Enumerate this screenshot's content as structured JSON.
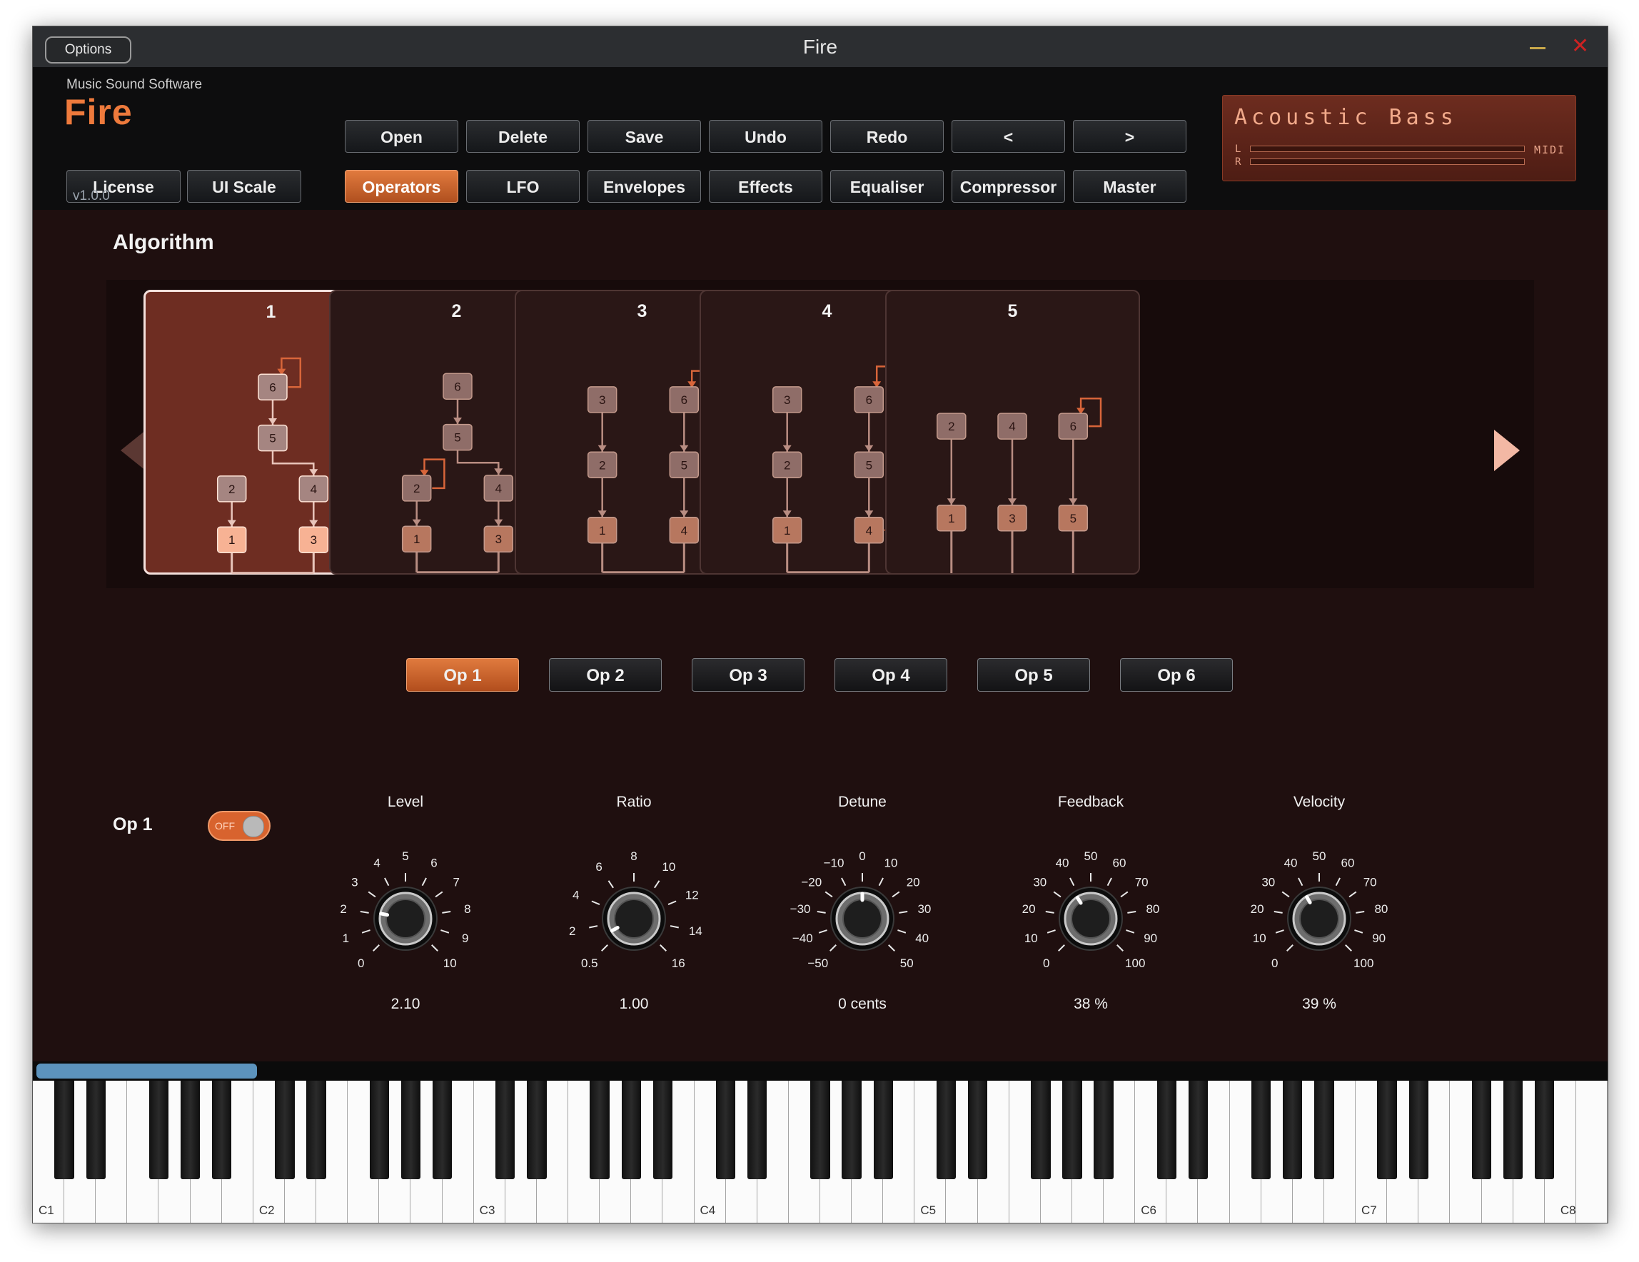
{
  "window": {
    "title": "Fire",
    "options_label": "Options"
  },
  "brand": {
    "company": "Music Sound Software",
    "name": "Fire",
    "version": "v1.0.0"
  },
  "header": {
    "left_buttons": [
      "License",
      "UI Scale"
    ],
    "top_row": [
      "Open",
      "Delete",
      "Save",
      "Undo",
      "Redo",
      "<",
      ">"
    ],
    "tabs": [
      "Operators",
      "LFO",
      "Envelopes",
      "Effects",
      "Equaliser",
      "Compressor",
      "Master"
    ],
    "active_tab": "Operators"
  },
  "preset": {
    "name": "Acoustic Bass",
    "meter_left": "L",
    "meter_right": "R",
    "midi": "MIDI"
  },
  "algorithm": {
    "title": "Algorithm",
    "selected": "1",
    "cards": [
      {
        "label": "1"
      },
      {
        "label": "2"
      },
      {
        "label": "3"
      },
      {
        "label": "4"
      },
      {
        "label": "5"
      }
    ]
  },
  "operators": {
    "buttons": [
      "Op 1",
      "Op 2",
      "Op 3",
      "Op 4",
      "Op 5",
      "Op 6"
    ],
    "active": "Op 1"
  },
  "op_panel": {
    "label": "Op 1",
    "toggle_text": "OFF",
    "knobs": [
      {
        "name": "Level",
        "value": "2.10",
        "ticks": [
          "0",
          "1",
          "2",
          "3",
          "4",
          "5",
          "6",
          "7",
          "8",
          "9",
          "10"
        ],
        "fraction": 0.21
      },
      {
        "name": "Ratio",
        "value": "1.00",
        "ticks": [
          "0.5",
          "2",
          "4",
          "6",
          "8",
          "10",
          "12",
          "14",
          "16"
        ],
        "fraction": 0.06
      },
      {
        "name": "Detune",
        "value": "0 cents",
        "ticks": [
          "−50",
          "−40",
          "−30",
          "−20",
          "−10",
          "0",
          "10",
          "20",
          "30",
          "40",
          "50"
        ],
        "fraction": 0.5
      },
      {
        "name": "Feedback",
        "value": "38 %",
        "ticks": [
          "0",
          "10",
          "20",
          "30",
          "40",
          "50",
          "60",
          "70",
          "80",
          "90",
          "100"
        ],
        "fraction": 0.38
      },
      {
        "name": "Velocity",
        "value": "39 %",
        "ticks": [
          "0",
          "10",
          "20",
          "30",
          "40",
          "50",
          "60",
          "70",
          "80",
          "90",
          "100"
        ],
        "fraction": 0.39
      }
    ]
  },
  "keyboard": {
    "octave_labels": [
      "C1",
      "C2",
      "C3",
      "C4",
      "C5",
      "C6",
      "C7",
      "C8"
    ]
  },
  "colors": {
    "accent": "#e07a3e",
    "background": "#1f0f0f",
    "brand": "#ee7a3c"
  }
}
